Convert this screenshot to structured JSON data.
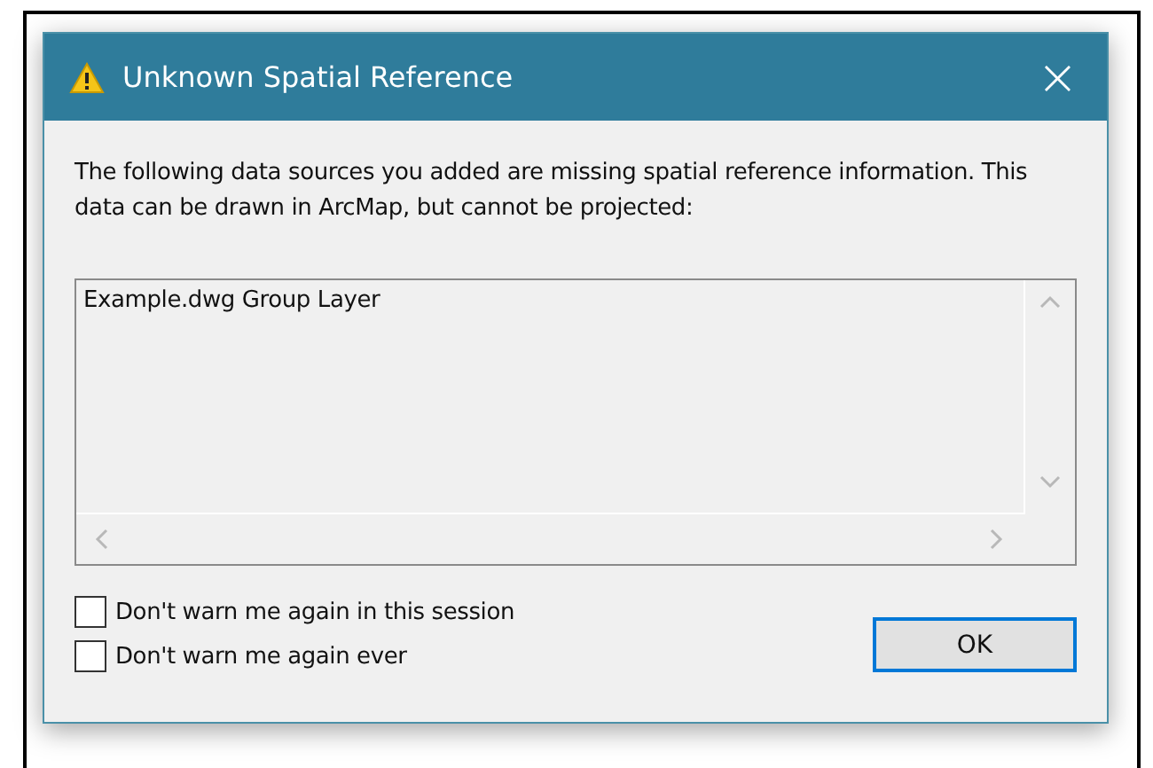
{
  "window": {
    "title": "Unknown Spatial Reference",
    "close": "×"
  },
  "message": "The following data sources you added are missing spatial reference information. This data can be drawn in ArcMap, but cannot be projected:",
  "list": {
    "items": [
      "Example.dwg Group Layer"
    ]
  },
  "options": [
    {
      "label": "Don't warn me again in this session",
      "checked": false
    },
    {
      "label": "Don't warn me again ever",
      "checked": false
    }
  ],
  "buttons": [
    {
      "label": "OK",
      "selected": true
    }
  ]
}
